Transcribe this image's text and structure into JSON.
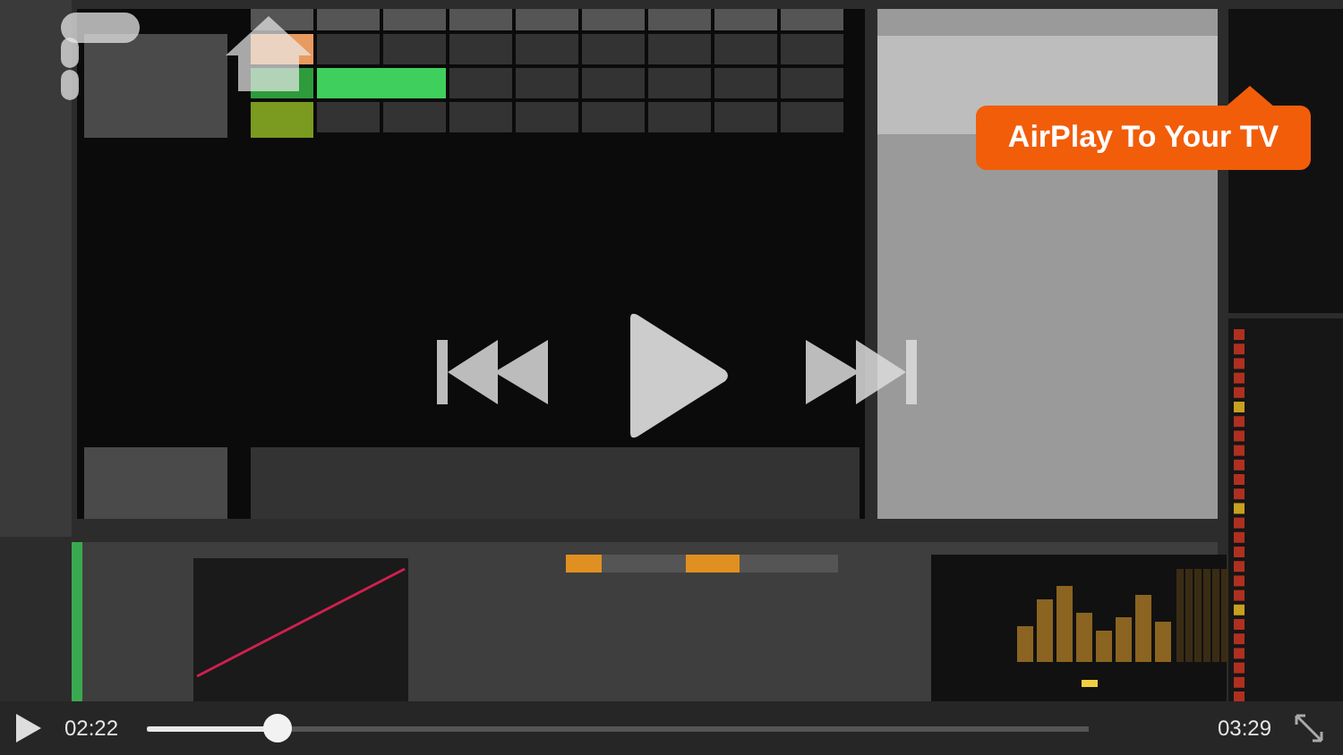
{
  "callout": {
    "text": "AirPlay To Your TV"
  },
  "player": {
    "playing": false,
    "elapsed": "02:22",
    "duration": "03:29",
    "level": 0.138
  }
}
